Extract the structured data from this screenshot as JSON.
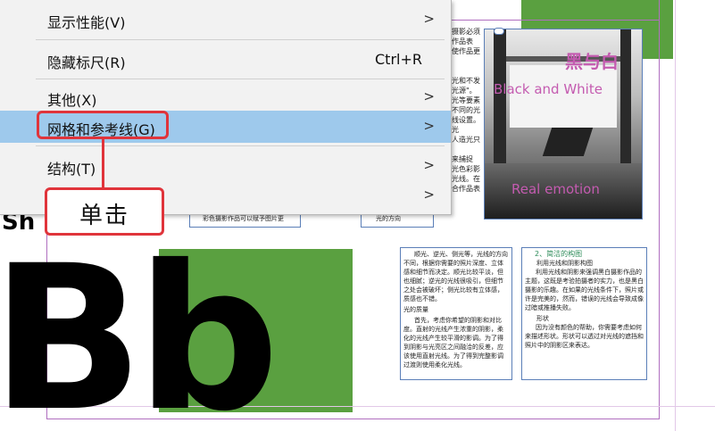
{
  "menu": {
    "items": [
      {
        "label": "显示性能(V)",
        "shortcut": "",
        "submenu": true,
        "highlighted": false
      },
      {
        "label": "隐藏标尺(R)",
        "shortcut": "Ctrl+R",
        "submenu": false,
        "highlighted": false
      },
      {
        "label": "其他(X)",
        "shortcut": "",
        "submenu": true,
        "highlighted": false
      },
      {
        "label": "网格和参考线(G)",
        "shortcut": "",
        "submenu": true,
        "highlighted": true
      },
      {
        "label": "结构(T)",
        "shortcut": "",
        "submenu": true,
        "highlighted": false
      },
      {
        "label": "",
        "shortcut": "",
        "submenu": true,
        "highlighted": false
      }
    ],
    "arrow_glyph": ">"
  },
  "annotation": {
    "click_label": "单击",
    "color": "#e0343b"
  },
  "document": {
    "big_letters": "Bb",
    "partial_letters": "Sh",
    "green_color": "#5aa040",
    "guide_color": "#b06fc0",
    "frame_color": "#5b7fb8",
    "photo": {
      "title_cn": "黑与白",
      "title_en": "Black and White",
      "subtitle": "Real emotion"
    },
    "col_a_tail": "彩色摄影作品可以赋予图片更",
    "col_b_tail": "光的方向",
    "col_c_fragments": [
      "摄影必须",
      "作品表",
      "使作品更",
      "光和不发",
      "光源\"。",
      "光等要素",
      "不同的光",
      "线设置。光",
      "人造光只",
      "来捕捉",
      "光色彩影",
      "光线。在",
      "合作品表"
    ],
    "text_left": "顺光、逆光、侧光等，光线的方向不同，根据你需要的照片深度、立体感和细节而决定。顺光比较平淡，但也细腻；逆光的光线很吸引，但细节之处会被破坏；侧光比较有立体感，质感也不错。",
    "text_left_heading": "光的质量",
    "text_left_2": "首先，考虑你希望的阴影和对比度。直射的光线产生浓重的阴影，柔化的光线产生较平滑的影调。为了得到阴影与光亮区之间融洽的反差，应该使用直射光线。为了得到完整影调过渡则使用柔化光线。",
    "text_right_heading": "2、简洁的构图",
    "text_right_sub": "利用光线和阴影构图",
    "text_right": "利用光线和阴影来强调黑白摄影作品的主题，这既是考验拍摄者的实力，也是黑白摄影的乐趣。在如果的光线条件下，照片或许是完美的，然而，错误的光线会导致成像过暗或推播失败。",
    "text_right_heading2": "形状",
    "text_right_2": "因为没有颜色的帮助，你需要考虑如何来描述形状。形状可以透过对光线的遮挡和照片中的阴影区来表达。"
  }
}
